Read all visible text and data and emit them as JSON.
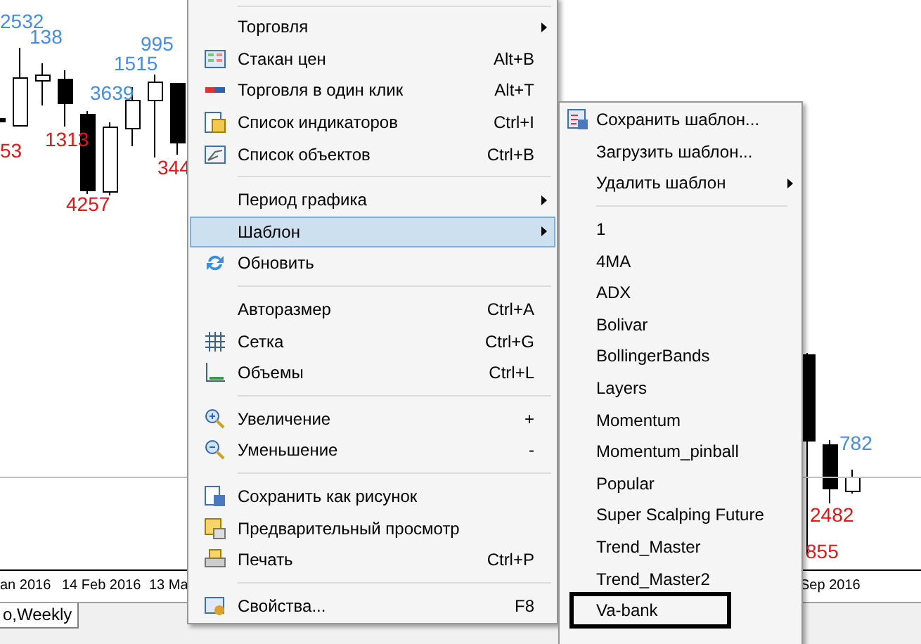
{
  "chart": {
    "labels": [
      {
        "text": "2532",
        "kind": "high"
      },
      {
        "text": "138",
        "kind": "high"
      },
      {
        "text": "995",
        "kind": "high"
      },
      {
        "text": "1515",
        "kind": "high"
      },
      {
        "text": "3639",
        "kind": "high"
      },
      {
        "text": "53",
        "kind": "low"
      },
      {
        "text": "1313",
        "kind": "low"
      },
      {
        "text": "344",
        "kind": "low"
      },
      {
        "text": "4257",
        "kind": "low"
      },
      {
        "text": "782",
        "kind": "high"
      },
      {
        "text": "2482",
        "kind": "low"
      },
      {
        "text": "855",
        "kind": "low"
      }
    ],
    "xaxis": [
      "an 2016",
      "14 Feb 2016",
      "13 Ma",
      "Sep 2016"
    ],
    "tab": {
      "label": "o,Weekly",
      "selected": true
    }
  },
  "menu": [
    {
      "kind": "item",
      "label": "Торговля",
      "submenu": true,
      "selected": false
    },
    {
      "kind": "item",
      "label": "Стакан цен",
      "shortcut": "Alt+B",
      "submenu": false,
      "selected": false
    },
    {
      "kind": "item",
      "label": "Торговля в один клик",
      "shortcut": "Alt+T",
      "submenu": false,
      "selected": false
    },
    {
      "kind": "item",
      "label": "Список индикаторов",
      "shortcut": "Ctrl+I",
      "submenu": false,
      "selected": false
    },
    {
      "kind": "item",
      "label": "Список объектов",
      "shortcut": "Ctrl+B",
      "submenu": false,
      "selected": false
    },
    {
      "kind": "separator"
    },
    {
      "kind": "item",
      "label": "Период графика",
      "submenu": true,
      "selected": false
    },
    {
      "kind": "item",
      "label": "Шаблон",
      "submenu": true,
      "selected": true
    },
    {
      "kind": "item",
      "label": "Обновить",
      "submenu": false,
      "selected": false
    },
    {
      "kind": "separator"
    },
    {
      "kind": "item",
      "label": "Авторазмер",
      "shortcut": "Ctrl+A",
      "submenu": false,
      "selected": false
    },
    {
      "kind": "item",
      "label": "Сетка",
      "shortcut": "Ctrl+G",
      "submenu": false,
      "selected": false
    },
    {
      "kind": "item",
      "label": "Объемы",
      "shortcut": "Ctrl+L",
      "submenu": false,
      "selected": false
    },
    {
      "kind": "separator"
    },
    {
      "kind": "item",
      "label": "Увеличение",
      "shortcut": "+",
      "submenu": false,
      "selected": false
    },
    {
      "kind": "item",
      "label": "Уменьшение",
      "shortcut": "-",
      "submenu": false,
      "selected": false
    },
    {
      "kind": "separator"
    },
    {
      "kind": "item",
      "label": "Сохранить как рисунок",
      "submenu": false,
      "selected": false
    },
    {
      "kind": "item",
      "label": "Предварительный просмотр",
      "submenu": false,
      "selected": false
    },
    {
      "kind": "item",
      "label": "Печать",
      "shortcut": "Ctrl+P",
      "submenu": false,
      "selected": false
    },
    {
      "kind": "separator"
    },
    {
      "kind": "item",
      "label": "Свойства...",
      "shortcut": "F8",
      "submenu": false,
      "selected": false
    }
  ],
  "submenu": [
    {
      "kind": "item",
      "label": "Сохранить шаблон...",
      "outlined": false
    },
    {
      "kind": "item",
      "label": "Загрузить шаблон...",
      "outlined": false
    },
    {
      "kind": "item",
      "label": "Удалить шаблон",
      "submenu": true,
      "outlined": false
    },
    {
      "kind": "separator"
    },
    {
      "kind": "item",
      "label": "1",
      "outlined": false
    },
    {
      "kind": "item",
      "label": "4MA",
      "outlined": false
    },
    {
      "kind": "item",
      "label": "ADX",
      "outlined": false
    },
    {
      "kind": "item",
      "label": "Bolivar",
      "outlined": false
    },
    {
      "kind": "item",
      "label": "BollingerBands",
      "outlined": false
    },
    {
      "kind": "item",
      "label": "Layers",
      "outlined": false
    },
    {
      "kind": "item",
      "label": "Momentum",
      "outlined": false
    },
    {
      "kind": "item",
      "label": "Momentum_pinball",
      "outlined": false
    },
    {
      "kind": "item",
      "label": "Popular",
      "outlined": false
    },
    {
      "kind": "item",
      "label": "Super Scalping Future",
      "outlined": false
    },
    {
      "kind": "item",
      "label": "Trend_Master",
      "outlined": false
    },
    {
      "kind": "item",
      "label": "Trend_Master2",
      "outlined": false
    },
    {
      "kind": "item",
      "label": "Va-bank",
      "outlined": true
    }
  ]
}
